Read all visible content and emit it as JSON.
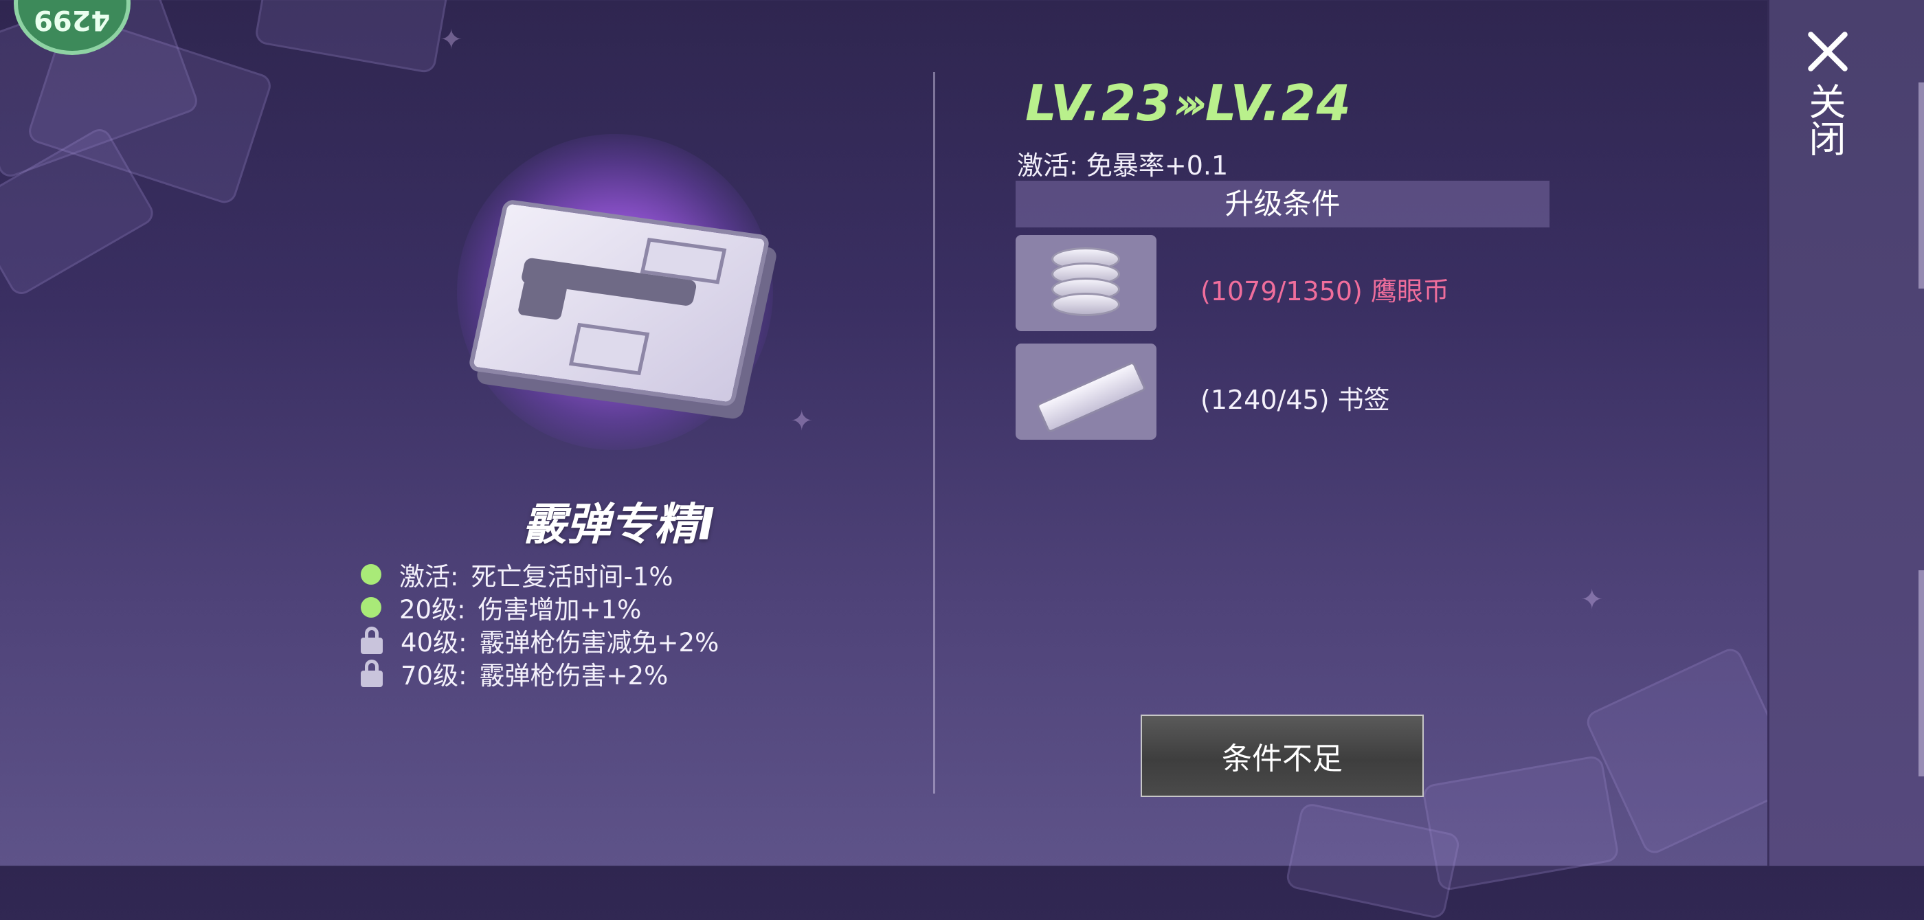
{
  "player": {
    "level_badge": "4299"
  },
  "item": {
    "name": "霰弹专精I",
    "icon": "shotgun-manual-icon",
    "effects": [
      {
        "status": "active",
        "prefix": "激活:",
        "text": "死亡复活时间-1%"
      },
      {
        "status": "active",
        "prefix": "20级:",
        "text": "伤害增加+1%"
      },
      {
        "status": "locked",
        "prefix": "40级:",
        "text": "霰弹枪伤害减免+2%"
      },
      {
        "status": "locked",
        "prefix": "70级:",
        "text": "霰弹枪伤害+2%"
      }
    ]
  },
  "upgrade": {
    "level_from": "LV.23",
    "level_arrow": "›››",
    "level_to": "LV.24",
    "activate_text": "激活: 免暴率+0.1",
    "conditions_header": "升级条件",
    "materials": [
      {
        "icon": "coin-icon",
        "text": "(1079/1350) 鹰眼币",
        "status": "insufficient"
      },
      {
        "icon": "bookmark-icon",
        "text": "(1240/45) 书签",
        "status": "sufficient"
      }
    ],
    "button_label": "条件不足"
  },
  "close": {
    "label": "关闭"
  },
  "colors": {
    "level_green": "#b9f08c",
    "insufficient_pink": "#f06e9c",
    "active_dot": "#a9ea78"
  }
}
